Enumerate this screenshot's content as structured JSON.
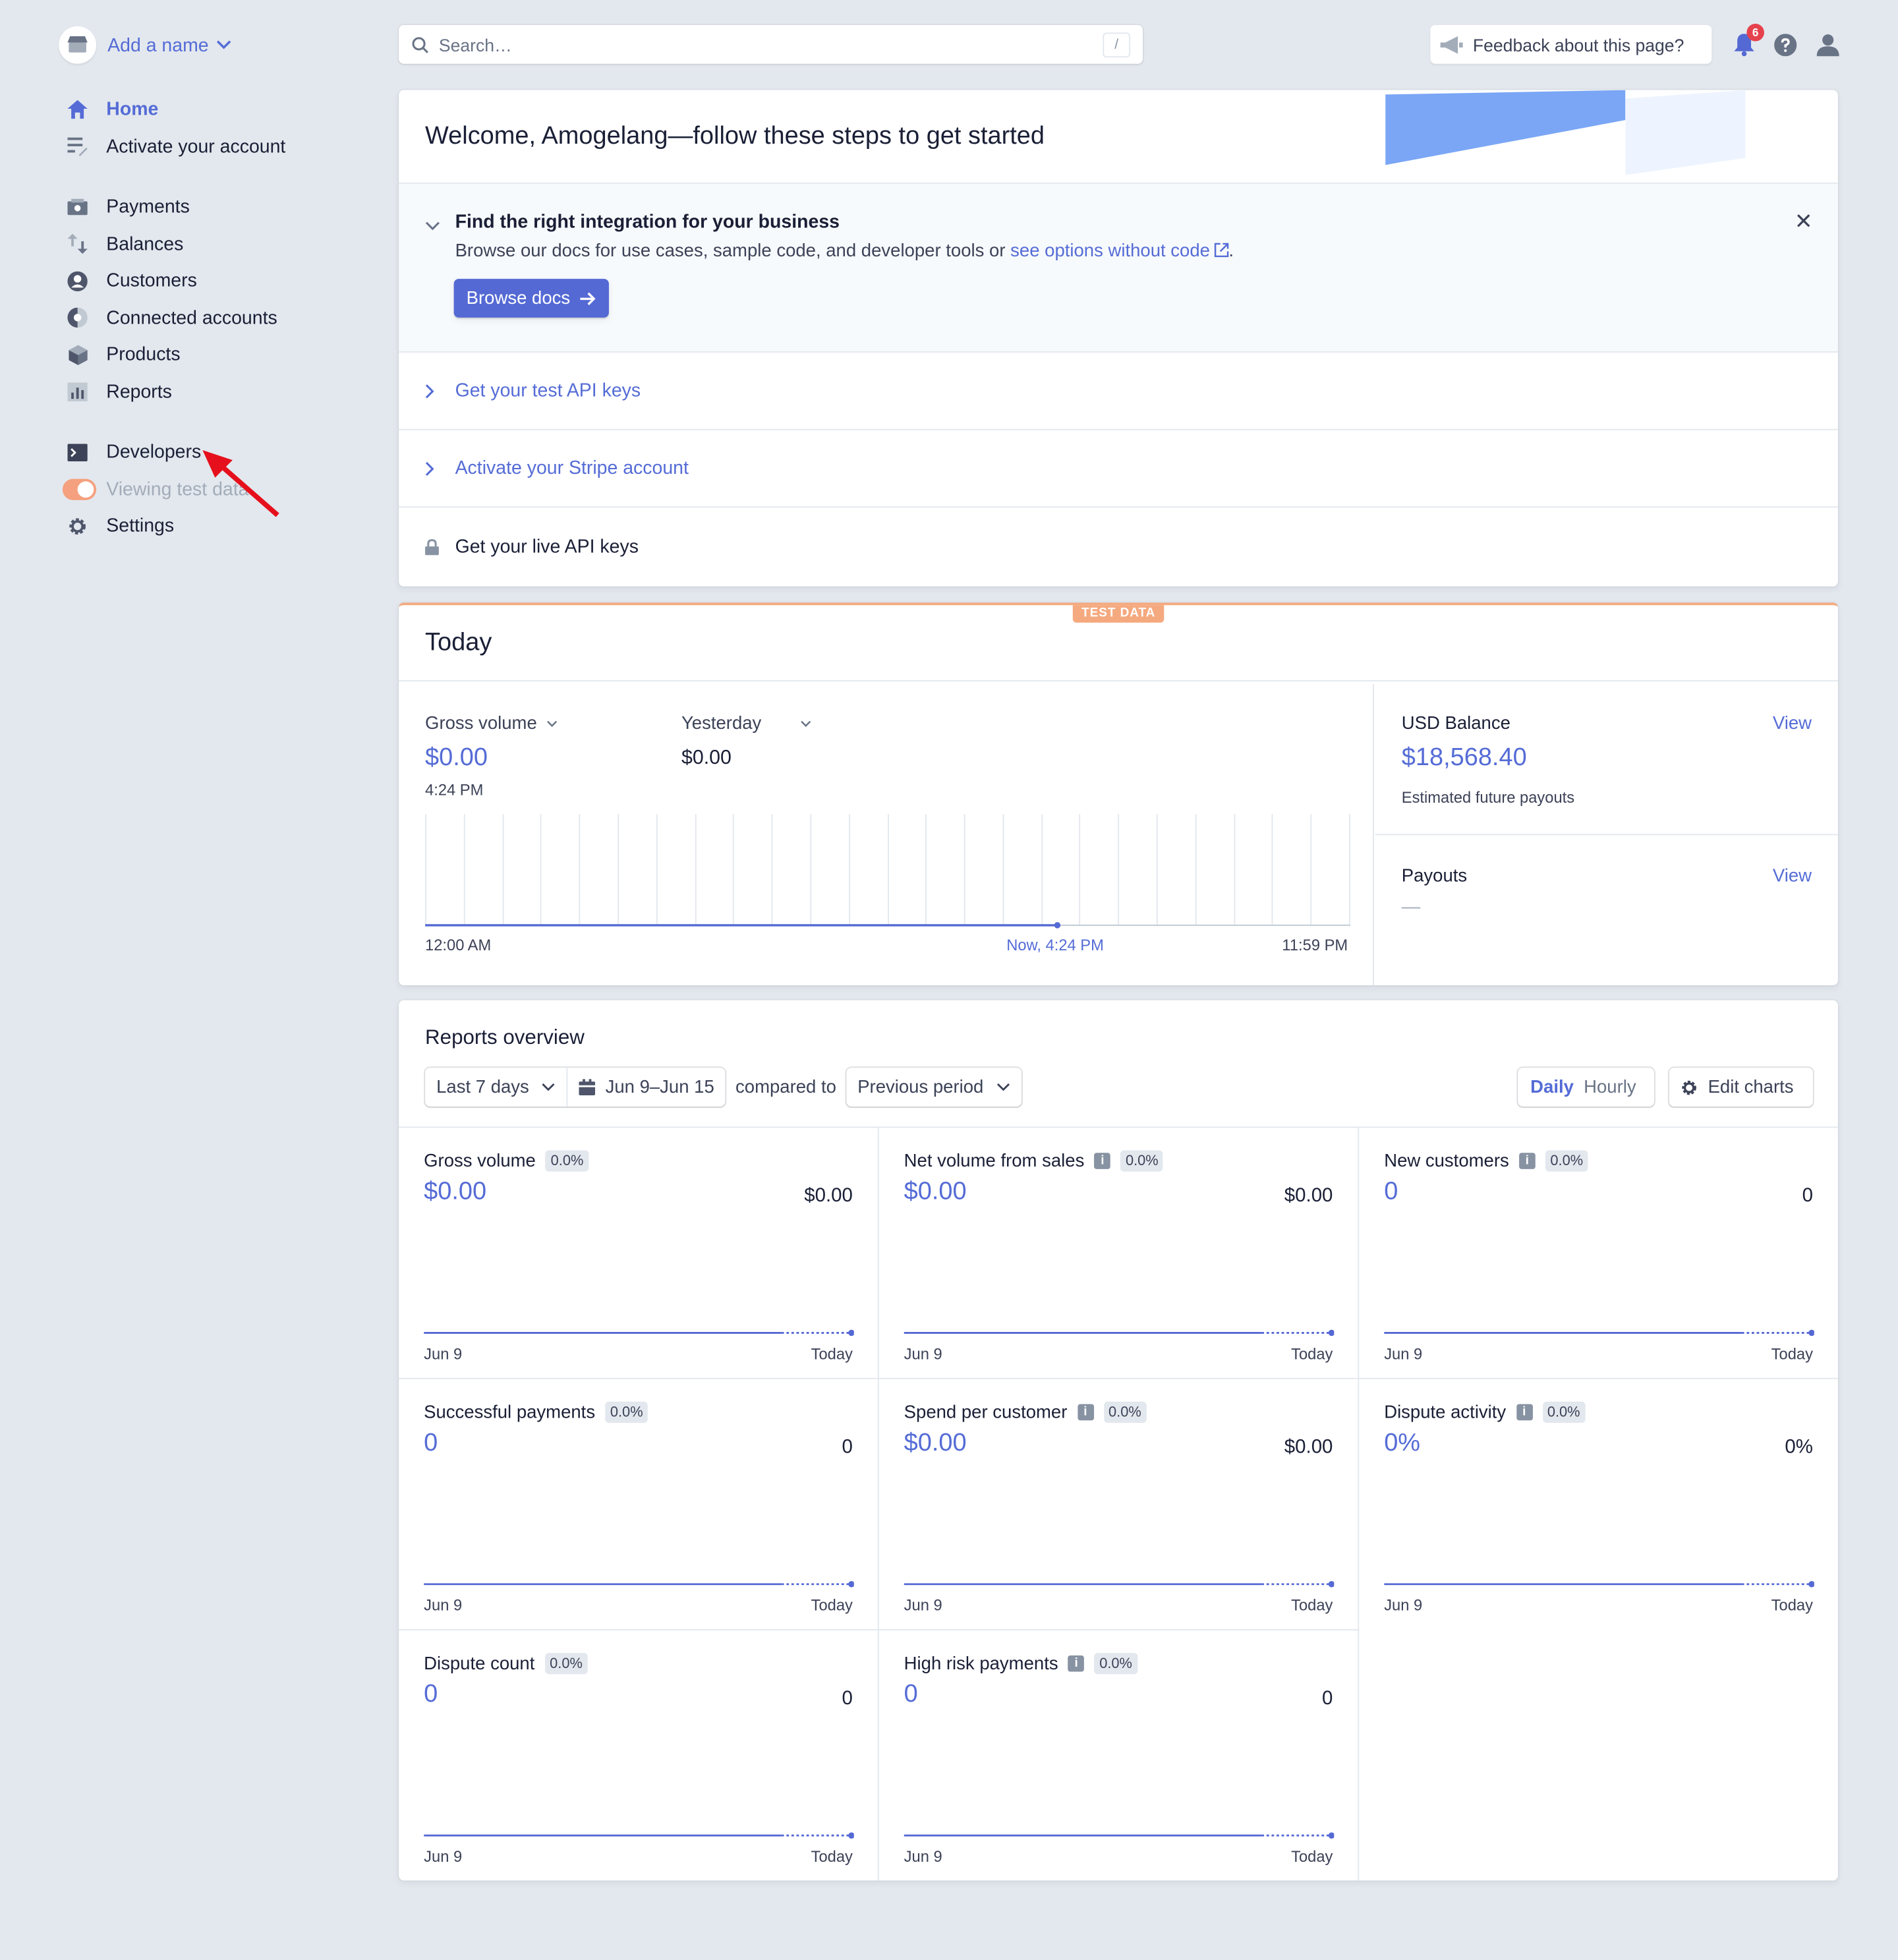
{
  "brand": {
    "name": "Add a name"
  },
  "sidebar": {
    "items": [
      {
        "label": "Home",
        "icon": "home-icon"
      },
      {
        "label": "Activate your account",
        "icon": "activate-icon"
      },
      {
        "label": "Payments",
        "icon": "payments-icon"
      },
      {
        "label": "Balances",
        "icon": "balances-icon"
      },
      {
        "label": "Customers",
        "icon": "customers-icon"
      },
      {
        "label": "Connected accounts",
        "icon": "connected-accounts-icon"
      },
      {
        "label": "Products",
        "icon": "products-icon"
      },
      {
        "label": "Reports",
        "icon": "reports-icon"
      },
      {
        "label": "Developers",
        "icon": "terminal-icon"
      },
      {
        "label": "Viewing test data",
        "icon": "toggle"
      },
      {
        "label": "Settings",
        "icon": "gear-icon"
      }
    ]
  },
  "topbar": {
    "search_placeholder": "Search…",
    "search_shortcut": "/",
    "feedback_label": "Feedback about this page?",
    "notification_count": "6"
  },
  "welcome": {
    "title": "Welcome, Amogelang—follow these steps to get started",
    "open_step": {
      "title": "Find the right integration for your business",
      "desc_prefix": "Browse our docs for use cases, sample code, and developer tools or ",
      "desc_link": "see options without code",
      "desc_suffix": ".",
      "button": "Browse docs"
    },
    "steps": [
      {
        "label": "Get your test API keys"
      },
      {
        "label": "Activate your Stripe account"
      },
      {
        "label": "Get your live API keys"
      }
    ]
  },
  "today": {
    "tag": "TEST DATA",
    "title": "Today",
    "metric_label": "Gross volume",
    "metric_value": "$0.00",
    "metric_time": "4:24 PM",
    "compare_label": "Yesterday",
    "compare_value": "$0.00",
    "axis_start": "12:00 AM",
    "axis_now": "Now, 4:24 PM",
    "axis_end": "11:59 PM",
    "balance_label": "USD Balance",
    "balance_value": "$18,568.40",
    "balance_sub": "Estimated future payouts",
    "payouts_label": "Payouts",
    "payouts_value": "—",
    "view_label": "View"
  },
  "reports": {
    "title": "Reports overview",
    "range": "Last 7 days",
    "dates": "Jun 9–Jun 15",
    "compared_to": "compared to",
    "period": "Previous period",
    "daily": "Daily",
    "hourly": "Hourly",
    "edit_charts": "Edit charts",
    "metrics": [
      {
        "name": "Gross volume",
        "pct": "0.0%",
        "info": false,
        "value": "$0.00",
        "compare": "$0.00",
        "start": "Jun 9",
        "end": "Today"
      },
      {
        "name": "Net volume from sales",
        "pct": "0.0%",
        "info": true,
        "value": "$0.00",
        "compare": "$0.00",
        "start": "Jun 9",
        "end": "Today"
      },
      {
        "name": "New customers",
        "pct": "0.0%",
        "info": true,
        "value": "0",
        "compare": "0",
        "start": "Jun 9",
        "end": "Today"
      },
      {
        "name": "Successful payments",
        "pct": "0.0%",
        "info": false,
        "value": "0",
        "compare": "0",
        "start": "Jun 9",
        "end": "Today"
      },
      {
        "name": "Spend per customer",
        "pct": "0.0%",
        "info": true,
        "value": "$0.00",
        "compare": "$0.00",
        "start": "Jun 9",
        "end": "Today"
      },
      {
        "name": "Dispute activity",
        "pct": "0.0%",
        "info": true,
        "value": "0%",
        "compare": "0%",
        "start": "Jun 9",
        "end": "Today"
      },
      {
        "name": "Dispute count",
        "pct": "0.0%",
        "info": false,
        "value": "0",
        "compare": "0",
        "start": "Jun 9",
        "end": "Today"
      },
      {
        "name": "High risk payments",
        "pct": "0.0%",
        "info": true,
        "value": "0",
        "compare": "0",
        "start": "Jun 9",
        "end": "Today"
      }
    ]
  },
  "colors": {
    "accent": "#556cd6",
    "test_data": "#f5a97f",
    "background": "#e3e8ee"
  }
}
